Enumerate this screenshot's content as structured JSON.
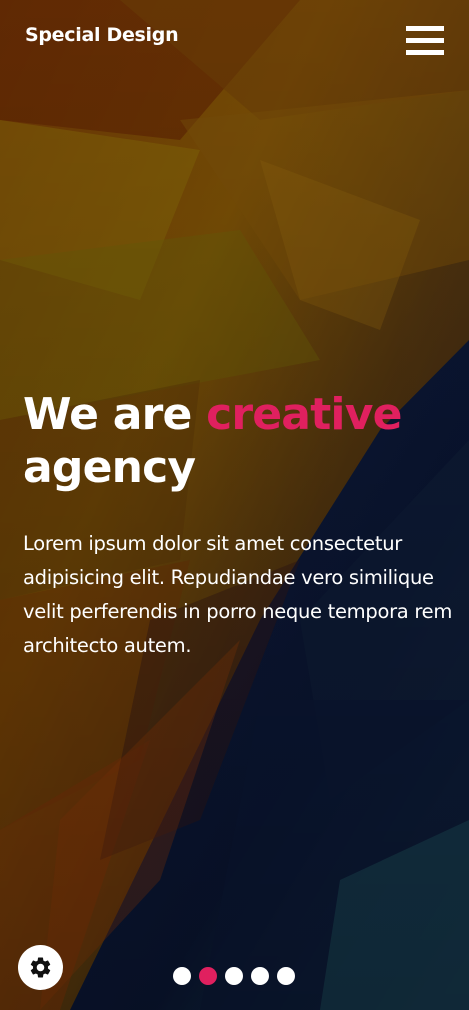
{
  "header": {
    "brand": "Special Design",
    "menu_icon": "hamburger-menu-icon"
  },
  "hero": {
    "title_prefix": "We are ",
    "title_accent": "creative",
    "title_suffix": "agency",
    "paragraph": "Lorem ipsum dolor sit amet consectetur adipisicing elit. Repudiandae vero similique velit perferendis in porro neque tempora rem architecto autem."
  },
  "settings": {
    "icon": "gear-icon"
  },
  "slider": {
    "slide_count": 5,
    "active_index": 2
  },
  "colors": {
    "accent": "#e0205f",
    "text": "#ffffff",
    "background_warm": "#8a4a05",
    "background_cool": "#0b1838"
  }
}
